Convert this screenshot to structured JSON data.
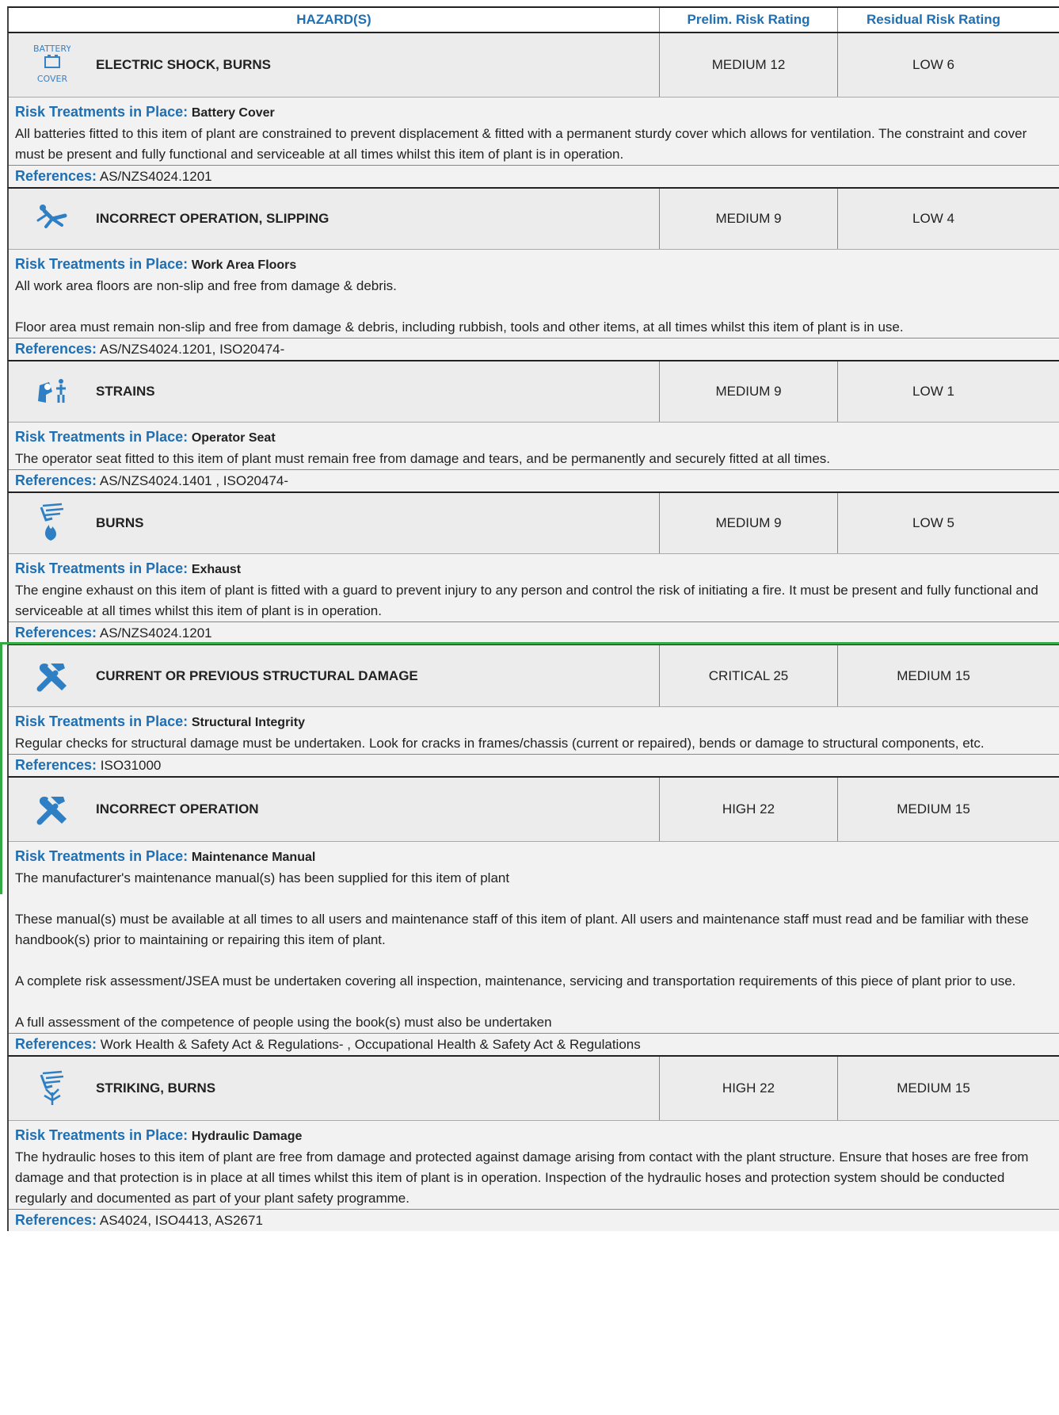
{
  "header": {
    "hazards": "HAZARD(S)",
    "prelim": "Prelim. Risk Rating",
    "residual": "Residual Risk Rating"
  },
  "labels": {
    "treatments": "Risk Treatments in Place:",
    "references": "References:"
  },
  "colors": {
    "accent": "#1f6fb2",
    "highlight_border": "#33aa44",
    "row_bg": "#ececec"
  },
  "hazards": [
    {
      "icon": "battery-cover-icon",
      "icon_text_top": "BATTERY",
      "icon_text_bottom": "COVER",
      "title": "ELECTRIC SHOCK, BURNS",
      "prelim": "MEDIUM 12",
      "residual": "LOW 6",
      "treatment": "Battery Cover",
      "paragraphs": [
        "All batteries fitted to this item of plant are constrained to prevent displacement & fitted with a permanent sturdy cover which allows for ventilation. The constraint and cover must be present and fully functional and serviceable at all times whilst this item of plant is in operation."
      ],
      "references": "AS/NZS4024.1201"
    },
    {
      "icon": "slipping-person-icon",
      "title": "INCORRECT OPERATION, SLIPPING",
      "prelim": "MEDIUM 9",
      "residual": "LOW 4",
      "treatment": "Work Area Floors",
      "paragraphs": [
        "All work area floors are non-slip and free from damage & debris.",
        "Floor area must remain non-slip and free from damage & debris, including rubbish, tools and other items, at all times whilst this item of plant is in use."
      ],
      "references": "AS/NZS4024.1201, ISO20474-"
    },
    {
      "icon": "strain-person-icon",
      "title": "STRAINS",
      "prelim": "MEDIUM 9",
      "residual": "LOW 1",
      "treatment": "Operator Seat",
      "paragraphs": [
        "The operator seat fitted to this item of plant must remain free from damage and tears, and be permanently and securely fitted at all times."
      ],
      "references": "AS/NZS4024.1401 , ISO20474-"
    },
    {
      "icon": "hand-fire-icon",
      "title": "BURNS",
      "prelim": "MEDIUM 9",
      "residual": "LOW 5",
      "treatment": "Exhaust",
      "paragraphs": [
        "The engine exhaust on this item of plant is fitted with a guard to prevent injury to any person and control the risk of initiating a fire. It must be present and fully functional and serviceable at all times whilst this item of plant is in operation."
      ],
      "references": "AS/NZS4024.1201"
    },
    {
      "icon": "tools-icon",
      "title": "CURRENT OR PREVIOUS STRUCTURAL DAMAGE",
      "prelim": "CRITICAL 25",
      "residual": "MEDIUM 15",
      "treatment": "Structural Integrity",
      "paragraphs": [
        "Regular checks for structural damage must be undertaken. Look for cracks in frames/chassis (current or repaired), bends or damage to structural components, etc."
      ],
      "references": "ISO31000"
    },
    {
      "icon": "tools-icon",
      "title": "INCORRECT OPERATION",
      "prelim": "HIGH 22",
      "residual": "MEDIUM 15",
      "treatment": "Maintenance Manual",
      "paragraphs": [
        "The manufacturer's maintenance manual(s) has been supplied for this item of plant",
        "These manual(s) must be available at all times to all users and maintenance staff of this item of plant. All users and maintenance staff must read and be familiar with these handbook(s) prior to maintaining or repairing this item of plant.",
        "A complete risk assessment/JSEA must be undertaken covering all inspection, maintenance, servicing and transportation requirements of this piece of plant prior to use.",
        "A full assessment of the competence of people using the book(s) must also be undertaken"
      ],
      "references": "Work Health & Safety Act & Regulations- , Occupational Health & Safety Act & Regulations"
    },
    {
      "icon": "hand-spray-icon",
      "title": "STRIKING, BURNS",
      "prelim": "HIGH 22",
      "residual": "MEDIUM 15",
      "treatment": "Hydraulic Damage",
      "paragraphs": [
        "The hydraulic hoses to this item of plant are free from damage and protected against damage arising from contact with the plant structure. Ensure that hoses are free from damage and that  protection is in place at all times whilst this item of plant is in operation. Inspection of the hydraulic hoses and  protection system should be conducted regularly and documented as part of your plant safety programme."
      ],
      "references": "AS4024, ISO4413, AS2671"
    }
  ]
}
